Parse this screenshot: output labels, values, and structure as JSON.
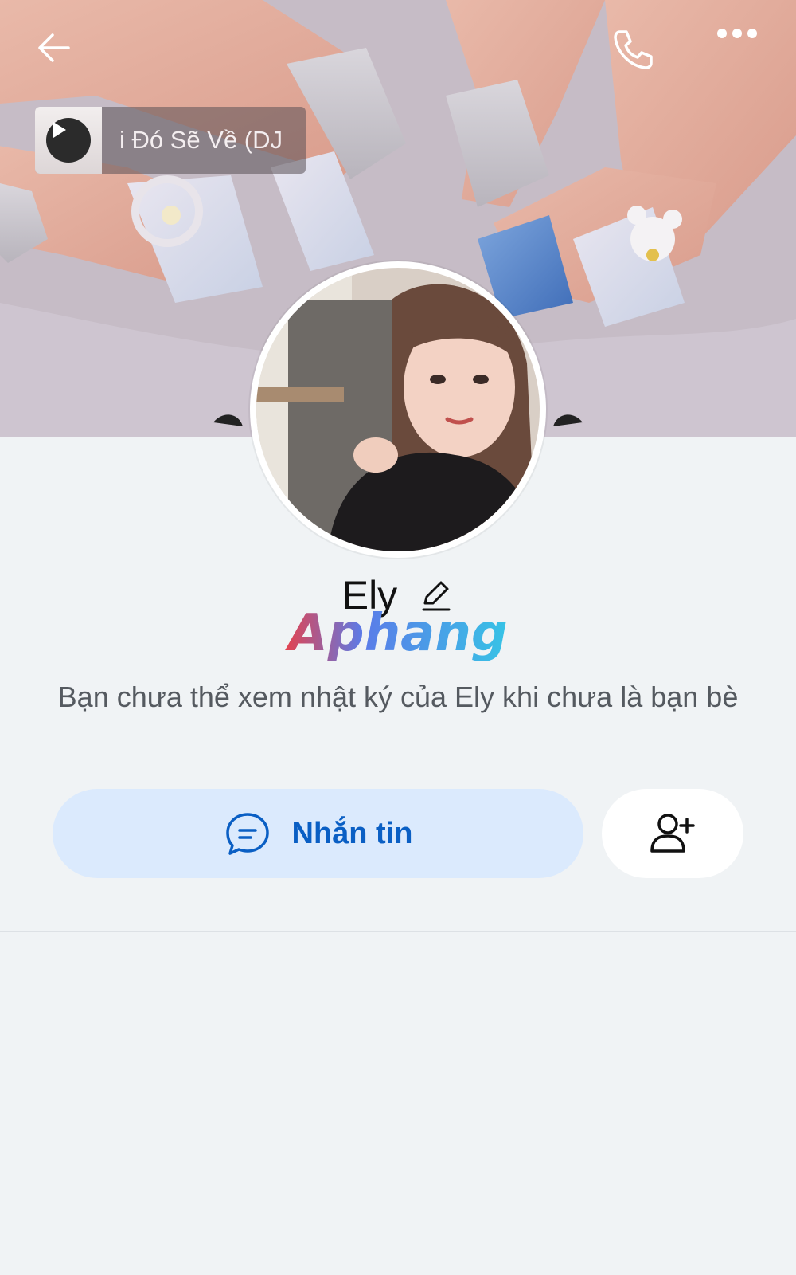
{
  "header": {
    "back_icon": "arrow-left-icon",
    "call_icon": "phone-icon",
    "more_icon": "more-dots-icon"
  },
  "music": {
    "title": "i Đó Sẽ Về (DJ",
    "icon": "play-icon"
  },
  "profile": {
    "name": "Ely",
    "edit_icon": "pencil-icon",
    "watermark_text": "Aphang"
  },
  "notice": {
    "text": "Bạn chưa thể xem nhật ký của Ely khi chưa là bạn bè"
  },
  "actions": {
    "message_label": "Nhắn tin",
    "message_icon": "chat-bubble-icon",
    "add_friend_icon": "add-friend-icon"
  },
  "colors": {
    "background": "#f0f3f5",
    "message_button_bg": "#dbeafd",
    "accent": "#0a5fc4"
  }
}
